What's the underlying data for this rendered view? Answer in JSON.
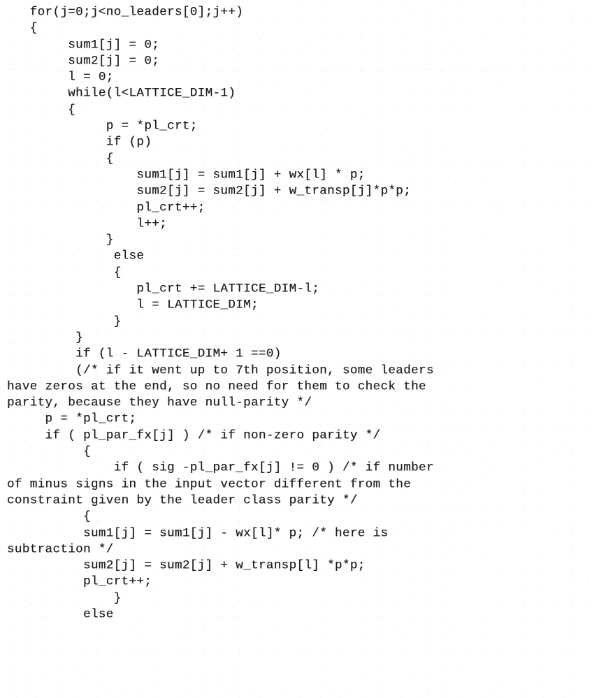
{
  "document": {
    "kind": "scanned-code-listing",
    "language": "C",
    "background_color": "#ffffff",
    "ink_color": "#1b1b1b",
    "lines": [
      "   for(j=0;j<no_leaders[0];j++)",
      "   {",
      "        sum1[j] = 0;",
      "        sum2[j] = 0;",
      "        l = 0;",
      "        while(l<LATTICE_DIM-1)",
      "        {",
      "             p = *pl_crt;",
      "             if (p)",
      "             {",
      "                 sum1[j] = sum1[j] + wx[l] * p;",
      "                 sum2[j] = sum2[j] + w_transp[j]*p*p;",
      "                 pl_crt++;",
      "                 l++;",
      "             }",
      "              else",
      "              {",
      "                 pl_crt += LATTICE_DIM-l;",
      "                 l = LATTICE_DIM;",
      "              }",
      "         }",
      "         if (l - LATTICE_DIM+ 1 ==0)",
      "         (/* if it went up to 7th position, some leaders",
      "have zeros at the end, so no need for them to check the",
      "parity, because they have null-parity */",
      "     p = *pl_crt;",
      "     if ( pl_par_fx[j] ) /* if non-zero parity */",
      "          {",
      "              if ( sig -pl_par_fx[j] != 0 ) /* if number",
      "of minus signs in the input vector different from the",
      "constraint given by the leader class parity */",
      "          {",
      "          sum1[j] = sum1[j] - wx[l]* p; /* here is",
      "subtraction */",
      "          sum2[j] = sum2[j] + w_transp[l] *p*p;",
      "          pl_crt++;",
      "              }",
      "          else"
    ]
  }
}
